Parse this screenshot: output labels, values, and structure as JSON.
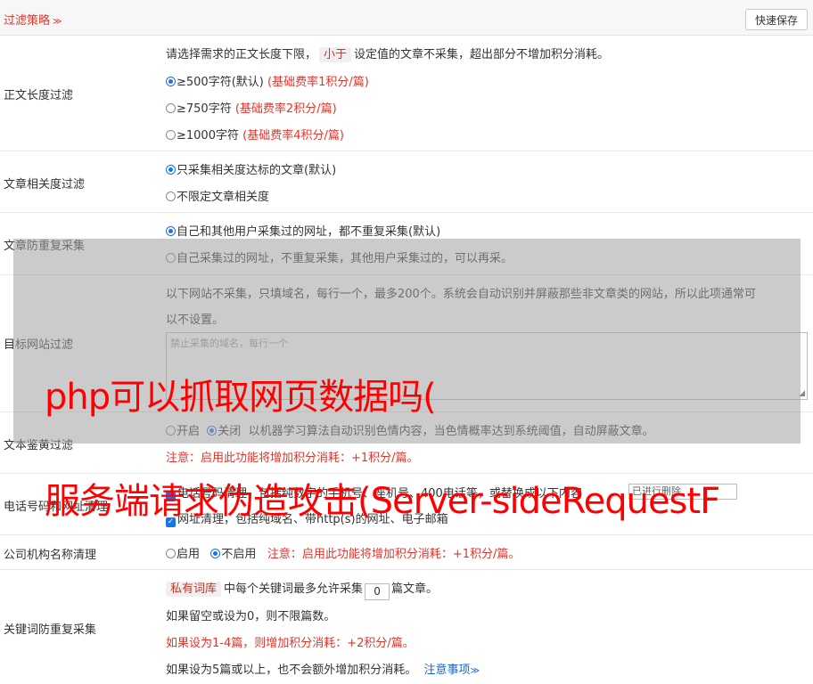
{
  "header": {
    "title": "过滤策略",
    "save_label": "快速保存"
  },
  "body_length": {
    "label": "正文长度过滤",
    "desc_pre": "请选择需求的正文长度下限，",
    "desc_chip": "小于",
    "desc_post": "设定值的文章不采集，超出部分不增加积分消耗。",
    "options": [
      {
        "label": "≥500字符(默认)",
        "note": "(基础费率1积分/篇)"
      },
      {
        "label": "≥750字符",
        "note": "(基础费率2积分/篇)"
      },
      {
        "label": "≥1000字符",
        "note": "(基础费率4积分/篇)"
      }
    ]
  },
  "relevance": {
    "label": "文章相关度过滤",
    "options": [
      "只采集相关度达标的文章(默认)",
      "不限定文章相关度"
    ]
  },
  "dedupe": {
    "label": "文章防重复采集",
    "options": [
      "自己和其他用户采集过的网址，都不重复采集(默认)",
      "自己采集过的网址，不重复采集，其他用户采集过的，可以再采。"
    ]
  },
  "site_filter": {
    "label": "目标网站过滤",
    "desc_line1": "以下网站不采集，只填域名，每行一个，最多200个。系统会自动识别并屏蔽那些非文章类的网站，所以此项通常可",
    "desc_line2": "以不设置。",
    "placeholder": "禁止采集的域名，每行一个"
  },
  "porn_filter": {
    "label": "文本鉴黄过滤",
    "on": "开启",
    "off": "关闭",
    "desc": "以机器学习算法自动识别色情内容，当色情概率达到系统阈值，自动屏蔽文章。",
    "note": "注意：启用此功能将增加积分消耗：+1积分/篇。"
  },
  "phone_url": {
    "label": "电话号码和网址清理",
    "line1": "电话号码清理，包括纯数字的手机号、座机号、400电话等，或替换成以下内容",
    "replace_value": "已进行删除",
    "line2": "网址清理，包括纯域名、带http(s)的网址、电子邮箱"
  },
  "company": {
    "label": "公司机构名称清理",
    "on": "启用",
    "off": "不启用",
    "note": "注意：启用此功能将增加积分消耗：+1积分/篇。"
  },
  "keyword_dedupe": {
    "label": "关键词防重复采集",
    "chip": "私有词库",
    "line1_pre": "中每个关键词最多允许采集",
    "value": "0",
    "line1_post": "篇文章。",
    "line2": "如果留空或设为0，则不限篇数。",
    "line3": "如果设为1-4篇，则增加积分消耗：+2积分/篇。",
    "line4": "如果设为5篇或以上，也不会额外增加积分消耗。",
    "link": "注意事项"
  },
  "watermark": {
    "line1": "php可以抓取网页数据吗(",
    "line2": "服务端请求伪造攻击(Server-sideRequestF"
  },
  "colors": {
    "accent": "#e0352b",
    "radio": "#1a73e8",
    "link": "#1a64c8"
  }
}
